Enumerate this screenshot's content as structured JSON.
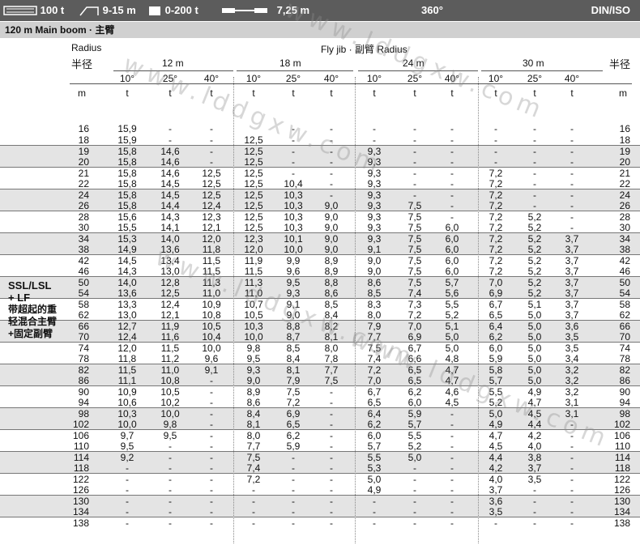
{
  "header": {
    "capacity": "100 t",
    "outrigger": "9-15 m",
    "counterweight": "0-200 t",
    "width": "7,25 m",
    "slew": "360°",
    "standard": "DIN/ISO"
  },
  "subheader": {
    "boom": "120 m   Main boom · 主臂"
  },
  "table": {
    "radius_label": "Radius",
    "radius_cn": "半径",
    "radius_cn_right": "半径",
    "flyjib_label": "Fly jib ·  副臂 Radius",
    "jib_lengths": [
      "12 m",
      "18 m",
      "24 m",
      "30 m"
    ],
    "angles": [
      "10°",
      "25°",
      "40°",
      "10°",
      "25°",
      "40°",
      "10°",
      "25°",
      "40°",
      "10°",
      "25°",
      "40°"
    ],
    "unit_m": "m",
    "unit_t": "t",
    "side_label_1": "SSL/LSL",
    "side_label_2": "+ LF",
    "side_label_3": "带超起的重",
    "side_label_4": "轻混合主臂",
    "side_label_5": "+固定副臂",
    "rows": [
      {
        "r": "16",
        "v": [
          "15,9",
          "-",
          "-",
          "",
          "-",
          "-",
          "-",
          "-",
          "-",
          "-",
          "-",
          "-"
        ]
      },
      {
        "r": "18",
        "v": [
          "15,9",
          "-",
          "-",
          "12,5",
          "-",
          "-",
          "-",
          "-",
          "-",
          "-",
          "-",
          "-"
        ]
      },
      {
        "r": "19",
        "v": [
          "15,8",
          "14,6",
          "-",
          "12,5",
          "-",
          "-",
          "9,3",
          "-",
          "-",
          "-",
          "-",
          "-"
        ]
      },
      {
        "r": "20",
        "v": [
          "15,8",
          "14,6",
          "-",
          "12,5",
          "-",
          "-",
          "9,3",
          "-",
          "-",
          "-",
          "-",
          "-"
        ]
      },
      {
        "r": "21",
        "v": [
          "15,8",
          "14,6",
          "12,5",
          "12,5",
          "-",
          "-",
          "9,3",
          "-",
          "-",
          "7,2",
          "-",
          "-"
        ]
      },
      {
        "r": "22",
        "v": [
          "15,8",
          "14,5",
          "12,5",
          "12,5",
          "10,4",
          "-",
          "9,3",
          "-",
          "-",
          "7,2",
          "-",
          "-"
        ]
      },
      {
        "r": "24",
        "v": [
          "15,8",
          "14,5",
          "12,5",
          "12,5",
          "10,3",
          "-",
          "9,3",
          "-",
          "-",
          "7,2",
          "-",
          "-"
        ]
      },
      {
        "r": "26",
        "v": [
          "15,8",
          "14,4",
          "12,4",
          "12,5",
          "10,3",
          "9,0",
          "9,3",
          "7,5",
          "-",
          "7,2",
          "-",
          "-"
        ]
      },
      {
        "r": "28",
        "v": [
          "15,6",
          "14,3",
          "12,3",
          "12,5",
          "10,3",
          "9,0",
          "9,3",
          "7,5",
          "-",
          "7,2",
          "5,2",
          "-"
        ]
      },
      {
        "r": "30",
        "v": [
          "15,5",
          "14,1",
          "12,1",
          "12,5",
          "10,3",
          "9,0",
          "9,3",
          "7,5",
          "6,0",
          "7,2",
          "5,2",
          "-"
        ]
      },
      {
        "r": "34",
        "v": [
          "15,3",
          "14,0",
          "12,0",
          "12,3",
          "10,1",
          "9,0",
          "9,3",
          "7,5",
          "6,0",
          "7,2",
          "5,2",
          "3,7"
        ]
      },
      {
        "r": "38",
        "v": [
          "14,9",
          "13,6",
          "11,8",
          "12,0",
          "10,0",
          "9,0",
          "9,1",
          "7,5",
          "6,0",
          "7,2",
          "5,2",
          "3,7"
        ]
      },
      {
        "r": "42",
        "v": [
          "14,5",
          "13,4",
          "11,5",
          "11,9",
          "9,9",
          "8,9",
          "9,0",
          "7,5",
          "6,0",
          "7,2",
          "5,2",
          "3,7"
        ]
      },
      {
        "r": "46",
        "v": [
          "14,3",
          "13,0",
          "11,5",
          "11,5",
          "9,6",
          "8,9",
          "9,0",
          "7,5",
          "6,0",
          "7,2",
          "5,2",
          "3,7"
        ]
      },
      {
        "r": "50",
        "v": [
          "14,0",
          "12,8",
          "11,3",
          "11,3",
          "9,5",
          "8,8",
          "8,6",
          "7,5",
          "5,7",
          "7,0",
          "5,2",
          "3,7"
        ]
      },
      {
        "r": "54",
        "v": [
          "13,6",
          "12,5",
          "11,0",
          "11,0",
          "9,3",
          "8,6",
          "8,5",
          "7,4",
          "5,6",
          "6,9",
          "5,2",
          "3,7"
        ]
      },
      {
        "r": "58",
        "v": [
          "13,3",
          "12,4",
          "10,9",
          "10,7",
          "9,1",
          "8,5",
          "8,3",
          "7,3",
          "5,5",
          "6,7",
          "5,1",
          "3,7"
        ]
      },
      {
        "r": "62",
        "v": [
          "13,0",
          "12,1",
          "10,8",
          "10,5",
          "9,0",
          "8,4",
          "8,0",
          "7,2",
          "5,2",
          "6,5",
          "5,0",
          "3,7"
        ]
      },
      {
        "r": "66",
        "v": [
          "12,7",
          "11,9",
          "10,5",
          "10,3",
          "8,8",
          "8,2",
          "7,9",
          "7,0",
          "5,1",
          "6,4",
          "5,0",
          "3,6"
        ]
      },
      {
        "r": "70",
        "v": [
          "12,4",
          "11,6",
          "10,4",
          "10,0",
          "8,7",
          "8,1",
          "7,7",
          "6,9",
          "5,0",
          "6,2",
          "5,0",
          "3,5"
        ]
      },
      {
        "r": "74",
        "v": [
          "12,0",
          "11,5",
          "10,0",
          "9,8",
          "8,5",
          "8,0",
          "7,5",
          "6,7",
          "5,0",
          "6,0",
          "5,0",
          "3,5"
        ]
      },
      {
        "r": "78",
        "v": [
          "11,8",
          "11,2",
          "9,6",
          "9,5",
          "8,4",
          "7,8",
          "7,4",
          "6,6",
          "4,8",
          "5,9",
          "5,0",
          "3,4"
        ]
      },
      {
        "r": "82",
        "v": [
          "11,5",
          "11,0",
          "9,1",
          "9,3",
          "8,1",
          "7,7",
          "7,2",
          "6,5",
          "4,7",
          "5,8",
          "5,0",
          "3,2"
        ]
      },
      {
        "r": "86",
        "v": [
          "11,1",
          "10,8",
          "-",
          "9,0",
          "7,9",
          "7,5",
          "7,0",
          "6,5",
          "4,7",
          "5,7",
          "5,0",
          "3,2"
        ]
      },
      {
        "r": "90",
        "v": [
          "10,9",
          "10,5",
          "-",
          "8,9",
          "7,5",
          "-",
          "6,7",
          "6,2",
          "4,6",
          "5,5",
          "4,9",
          "3,2"
        ]
      },
      {
        "r": "94",
        "v": [
          "10,6",
          "10,2",
          "-",
          "8,6",
          "7,2",
          "-",
          "6,5",
          "6,0",
          "4,5",
          "5,2",
          "4,7",
          "3,1"
        ]
      },
      {
        "r": "98",
        "v": [
          "10,3",
          "10,0",
          "-",
          "8,4",
          "6,9",
          "-",
          "6,4",
          "5,9",
          "-",
          "5,0",
          "4,5",
          "3,1"
        ]
      },
      {
        "r": "102",
        "v": [
          "10,0",
          "9,8",
          "-",
          "8,1",
          "6,5",
          "-",
          "6,2",
          "5,7",
          "-",
          "4,9",
          "4,4",
          "-"
        ]
      },
      {
        "r": "106",
        "v": [
          "9,7",
          "9,5",
          "-",
          "8,0",
          "6,2",
          "-",
          "6,0",
          "5,5",
          "-",
          "4,7",
          "4,2",
          "-"
        ]
      },
      {
        "r": "110",
        "v": [
          "9,5",
          "-",
          "-",
          "7,7",
          "5,9",
          "-",
          "5,7",
          "5,2",
          "-",
          "4,5",
          "4,0",
          "-"
        ]
      },
      {
        "r": "114",
        "v": [
          "9,2",
          "-",
          "-",
          "7,5",
          "-",
          "-",
          "5,5",
          "5,0",
          "-",
          "4,4",
          "3,8",
          "-"
        ]
      },
      {
        "r": "118",
        "v": [
          "-",
          "-",
          "-",
          "7,4",
          "-",
          "-",
          "5,3",
          "-",
          "-",
          "4,2",
          "3,7",
          "-"
        ]
      },
      {
        "r": "122",
        "v": [
          "-",
          "-",
          "-",
          "7,2",
          "-",
          "-",
          "5,0",
          "-",
          "-",
          "4,0",
          "3,5",
          "-"
        ]
      },
      {
        "r": "126",
        "v": [
          "-",
          "-",
          "-",
          "-",
          "-",
          "-",
          "4,9",
          "-",
          "-",
          "3,7",
          "-",
          "-"
        ]
      },
      {
        "r": "130",
        "v": [
          "-",
          "-",
          "-",
          "-",
          "-",
          "-",
          "-",
          "-",
          "-",
          "3,6",
          "-",
          "-"
        ]
      },
      {
        "r": "134",
        "v": [
          "-",
          "-",
          "-",
          "-",
          "-",
          "-",
          "-",
          "-",
          "-",
          "3,5",
          "-",
          "-"
        ]
      },
      {
        "r": "138",
        "v": [
          "-",
          "-",
          "-",
          "-",
          "-",
          "-",
          "-",
          "-",
          "-",
          "-",
          "-",
          "-"
        ]
      }
    ]
  },
  "watermark": "www.lddgxw.com"
}
